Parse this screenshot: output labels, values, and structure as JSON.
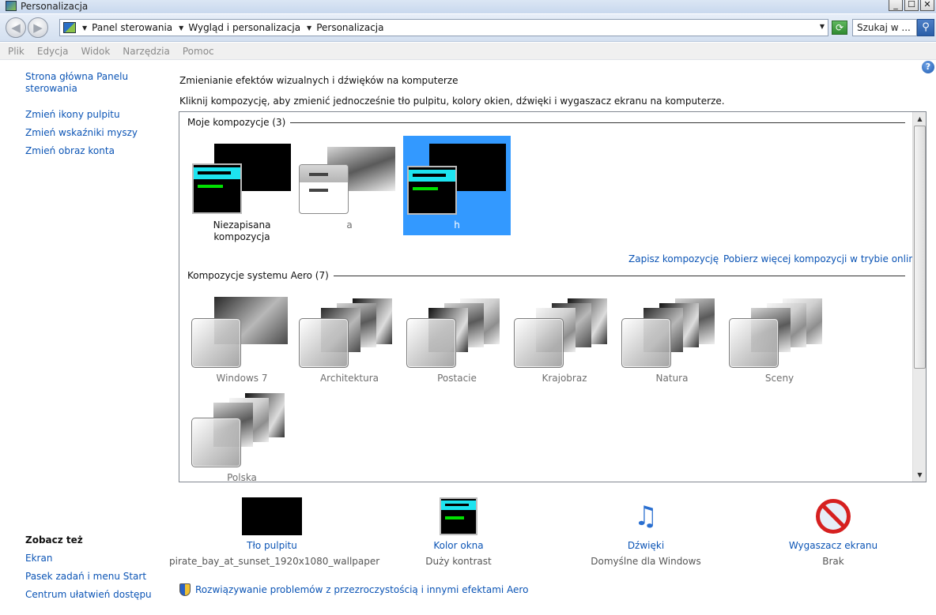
{
  "window": {
    "title": "Personalizacja",
    "minimize": "_",
    "maximize": "☐",
    "close": "✕"
  },
  "address": {
    "crumbs": [
      "Panel sterowania",
      "Wygląd i personalizacja",
      "Personalizacja"
    ],
    "search_placeholder": "Szukaj w ..."
  },
  "menu": [
    "Plik",
    "Edycja",
    "Widok",
    "Narzędzia",
    "Pomoc"
  ],
  "left_pane": {
    "links": [
      "Strona główna Panelu sterowania",
      "Zmień ikony pulpitu",
      "Zmień wskaźniki myszy",
      "Zmień obraz konta"
    ],
    "see_also_heading": "Zobacz też",
    "see_also": [
      "Ekran",
      "Pasek zadań i menu Start",
      "Centrum ułatwień dostępu"
    ]
  },
  "main": {
    "title": "Zmienianie efektów wizualnych i dźwięków na komputerze",
    "description": "Kliknij kompozycję, aby zmienić jednocześnie tło pulpitu, kolory okien, dźwięki i wygaszacz ekranu na komputerze.",
    "my_themes": {
      "heading": "Moje kompozycje (3)",
      "items": [
        {
          "label": "Niezapisana kompozycja",
          "selected": false
        },
        {
          "label": "a",
          "selected": false
        },
        {
          "label": "h",
          "selected": true
        }
      ],
      "save_link": "Zapisz kompozycję",
      "more_link": "Pobierz więcej kompozycji w trybie online"
    },
    "aero_themes": {
      "heading": "Kompozycje systemu Aero (7)",
      "items": [
        "Windows 7",
        "Architektura",
        "Postacie",
        "Krajobraz",
        "Natura",
        "Sceny",
        "Polska"
      ]
    }
  },
  "bottom": {
    "items": [
      {
        "label": "Tło pulpitu",
        "value": "pirate_bay_at_sunset_1920x1080_wallpaper"
      },
      {
        "label": "Kolor okna",
        "value": "Duży kontrast"
      },
      {
        "label": "Dźwięki",
        "value": "Domyślne dla Windows"
      },
      {
        "label": "Wygaszacz ekranu",
        "value": "Brak"
      }
    ],
    "troubleshoot": "Rozwiązywanie problemów z przezroczystością i innymi efektami Aero"
  },
  "colors": {
    "link": "#0b54b5",
    "selection": "#3399ff",
    "high_contrast_cyan": "#1de4f0",
    "high_contrast_green": "#00e000"
  }
}
